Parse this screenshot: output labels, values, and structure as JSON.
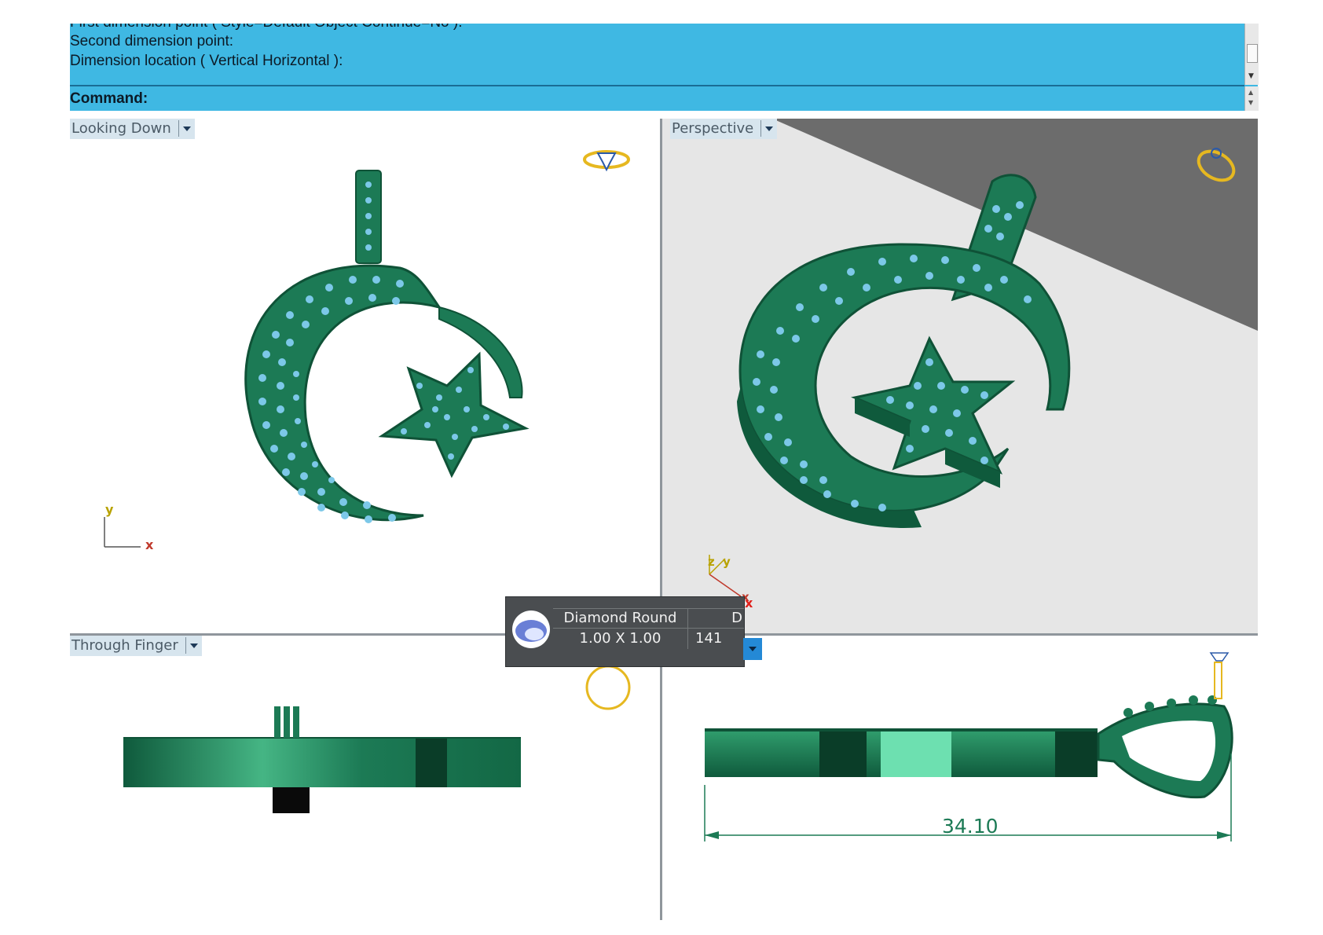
{
  "command_area": {
    "history": [
      "First dimension point ( Style=Default  Object  Continue=No ):",
      "Second dimension point:",
      "Dimension location ( Vertical  Horizontal ):"
    ],
    "prompt": "Command:"
  },
  "viewports": {
    "top_left": {
      "title": "Looking Down",
      "axis_x": "x",
      "axis_y": "y"
    },
    "top_right": {
      "title": "Perspective",
      "axis_x": "x",
      "axis_y": "y",
      "axis_z": "z"
    },
    "bottom_left": {
      "title": "Through Finger"
    },
    "bottom_right": {
      "dimension": "34.10"
    }
  },
  "tooltip": {
    "name": "Diamond Round",
    "size": "1.00 X 1.00",
    "col2_header": "D",
    "col2_value": "141"
  },
  "colors": {
    "command_bg": "#3fb8e3",
    "model_green": "#1c7a55",
    "gem_blue": "#7cc8e8",
    "widget_gold": "#e6b820"
  }
}
